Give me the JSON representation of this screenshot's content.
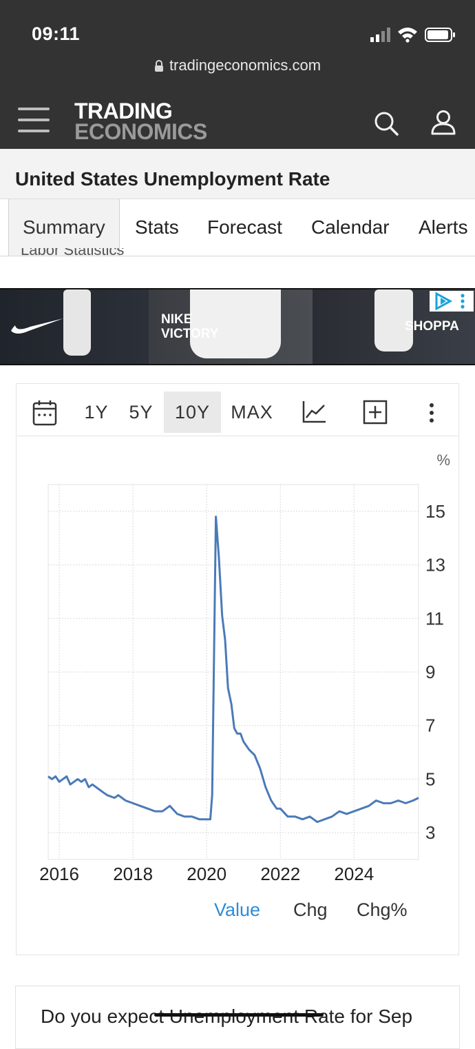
{
  "status": {
    "time": "09:11",
    "url": "tradingeconomics.com"
  },
  "nav": {
    "logo_line1": "TRADING",
    "logo_line2": "ECONOMICS",
    "icons": [
      "menu-icon",
      "search-icon",
      "user-icon"
    ]
  },
  "page": {
    "title": "United States Unemployment Rate",
    "truncated_source": "Labor Statistics"
  },
  "tabs": [
    {
      "label": "Summary",
      "active": true
    },
    {
      "label": "Stats"
    },
    {
      "label": "Forecast"
    },
    {
      "label": "Calendar"
    },
    {
      "label": "Alerts"
    }
  ],
  "ad": {
    "brand_text": "NIKE",
    "product_text": "VICTORY",
    "shop_text": "SHOPPA"
  },
  "toolbar": {
    "ranges": [
      "1Y",
      "5Y",
      "10Y",
      "MAX"
    ],
    "active_range": "10Y",
    "icons": [
      "calendar-icon",
      "line-chart-icon",
      "add-icon",
      "more-icon"
    ]
  },
  "chart": {
    "unit": "%",
    "legend": [
      "Value",
      "Chg",
      "Chg%"
    ],
    "active_legend": "Value",
    "line_color": "#4a7ab8"
  },
  "chart_data": {
    "type": "line",
    "ylabel": "%",
    "ylim": [
      2.0,
      16.0
    ],
    "yticks": [
      3,
      5,
      7,
      9,
      11,
      13,
      15
    ],
    "xlim": [
      2015.7,
      2025.75
    ],
    "xticks": [
      "2016",
      "2018",
      "2020",
      "2022",
      "2024"
    ],
    "grid": true,
    "series": [
      {
        "x": [
          2015.7,
          2015.8,
          2015.9,
          2016.0,
          2016.1,
          2016.2,
          2016.3,
          2016.4,
          2016.5,
          2016.6,
          2016.7,
          2016.8,
          2016.9,
          2017.0,
          2017.2,
          2017.3,
          2017.5,
          2017.6,
          2017.8,
          2018.0,
          2018.2,
          2018.4,
          2018.6,
          2018.8,
          2019.0,
          2019.2,
          2019.4,
          2019.6,
          2019.8,
          2020.0,
          2020.1,
          2020.15,
          2020.25,
          2020.33,
          2020.42,
          2020.5,
          2020.58,
          2020.67,
          2020.75,
          2020.83,
          2020.92,
          2021.0,
          2021.15,
          2021.3,
          2021.45,
          2021.6,
          2021.75,
          2021.9,
          2022.0,
          2022.2,
          2022.4,
          2022.6,
          2022.8,
          2023.0,
          2023.2,
          2023.4,
          2023.6,
          2023.8,
          2024.0,
          2024.2,
          2024.4,
          2024.6,
          2024.8,
          2025.0,
          2025.2,
          2025.4,
          2025.6,
          2025.75
        ],
        "y": [
          5.1,
          5.0,
          5.1,
          4.9,
          5.0,
          5.1,
          4.8,
          4.9,
          5.0,
          4.9,
          5.0,
          4.7,
          4.8,
          4.7,
          4.5,
          4.4,
          4.3,
          4.4,
          4.2,
          4.1,
          4.0,
          3.9,
          3.8,
          3.8,
          4.0,
          3.7,
          3.6,
          3.6,
          3.5,
          3.5,
          3.5,
          4.4,
          14.8,
          13.3,
          11.1,
          10.2,
          8.4,
          7.8,
          6.9,
          6.7,
          6.7,
          6.4,
          6.1,
          5.9,
          5.4,
          4.7,
          4.2,
          3.9,
          3.9,
          3.6,
          3.6,
          3.5,
          3.6,
          3.4,
          3.5,
          3.6,
          3.8,
          3.7,
          3.8,
          3.9,
          4.0,
          4.2,
          4.1,
          4.1,
          4.2,
          4.1,
          4.2,
          4.3
        ]
      }
    ]
  },
  "poll": {
    "text": "Do you expect Unemployment Rate for Sep"
  }
}
